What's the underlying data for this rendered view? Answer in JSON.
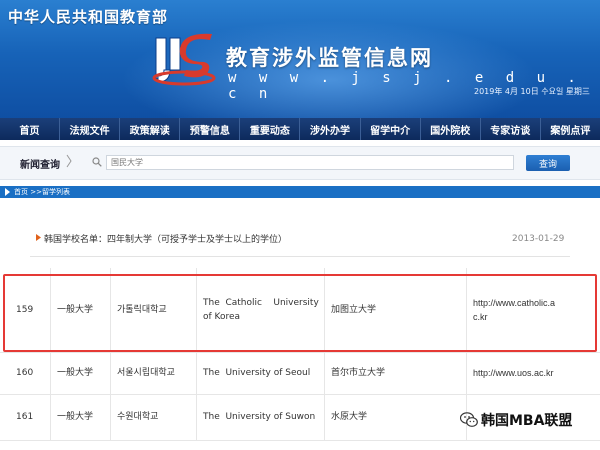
{
  "header": {
    "ministry": "中华人民共和国教育部",
    "site_title": "教育涉外监管信息网",
    "site_url": "w w w . j s j . e d u . c n",
    "date": "2019年 4月 10日 수요일 星期三"
  },
  "nav": [
    "首页",
    "法规文件",
    "政策解读",
    "预警信息",
    "重要动态",
    "涉外办学",
    "留学中介",
    "国外院校",
    "专家访谈",
    "案例点评"
  ],
  "search": {
    "label": "新闻查询",
    "placeholder": "国民大学",
    "button": "查询"
  },
  "breadcrumb": "首页 >>留学列表",
  "article": {
    "title": "韩国学校名单：四年制大学（可授予学士及学士以上的学位）",
    "date": "2013-01-29"
  },
  "table": {
    "rows": [
      {
        "no": "159",
        "type": "一般大学",
        "korean": "가톨릭대학교",
        "english": "The  Catholic    University of Korea",
        "chinese": "加图立大学",
        "url": "http://www.catholic.ac.kr"
      },
      {
        "no": "160",
        "type": "一般大学",
        "korean": "서울시립대학교",
        "english": "The  University of Seoul",
        "chinese": "首尔市立大学",
        "url": "http://www.uos.ac.kr"
      },
      {
        "no": "161",
        "type": "一般大学",
        "korean": "수원대학교",
        "english": "The  University of Suwon",
        "chinese": "水原大学",
        "url": ""
      }
    ]
  },
  "watermark": "韩国MBA联盟",
  "colors": {
    "header_blue": "#1763b8",
    "nav_navy": "#0d2a5c",
    "highlight_red": "#e53935",
    "crumb_blue": "#1a6fc4"
  }
}
